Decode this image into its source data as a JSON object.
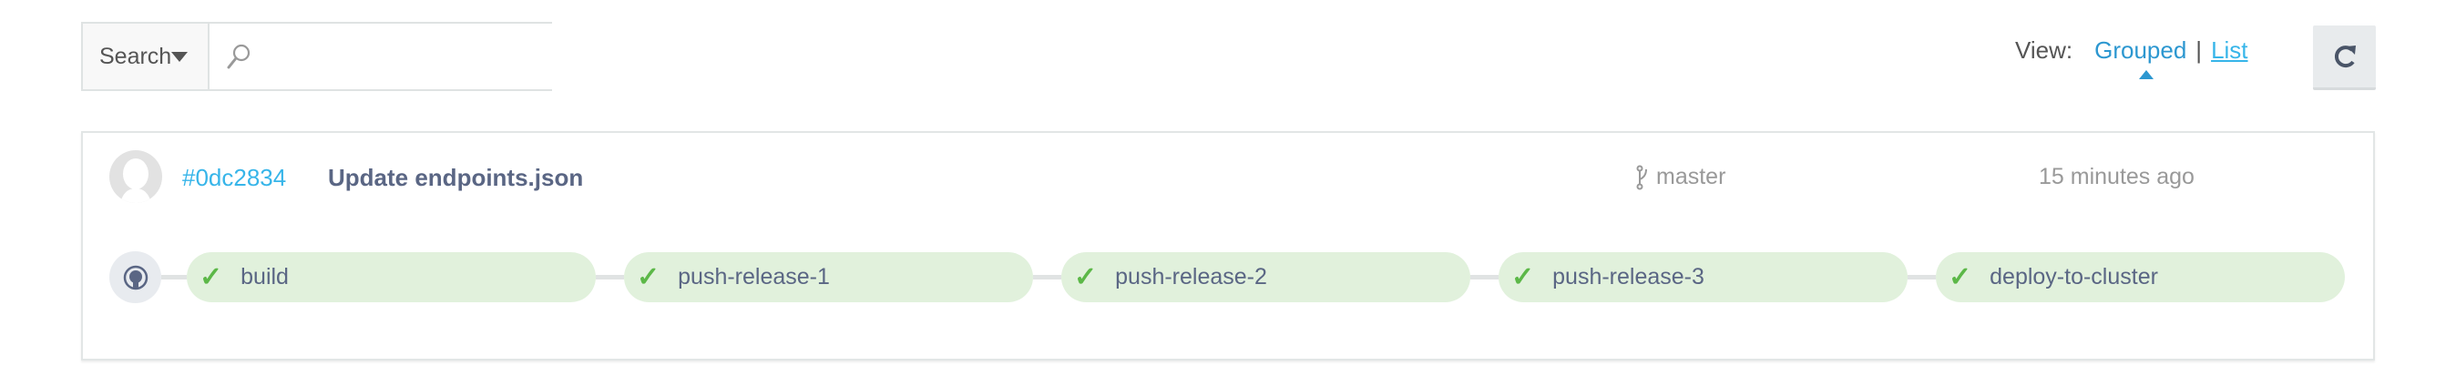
{
  "search": {
    "select_label": "Search",
    "input_value": "",
    "input_placeholder": ""
  },
  "view": {
    "label": "View:",
    "grouped": "Grouped",
    "separator": "|",
    "list": "List",
    "active": "Grouped"
  },
  "commit": {
    "hash": "#0dc2834",
    "title": "Update endpoints.json",
    "branch": "master",
    "time": "15 minutes ago"
  },
  "pipeline": {
    "steps": [
      {
        "label": "build",
        "status": "success"
      },
      {
        "label": "push-release-1",
        "status": "success"
      },
      {
        "label": "push-release-2",
        "status": "success"
      },
      {
        "label": "push-release-3",
        "status": "success"
      },
      {
        "label": "deploy-to-cluster",
        "status": "success"
      }
    ],
    "check": "✓"
  },
  "colors": {
    "link": "#37b5e9",
    "success_bg": "#e1f1dc",
    "success_check": "#5cb848",
    "title": "#5a6684"
  }
}
